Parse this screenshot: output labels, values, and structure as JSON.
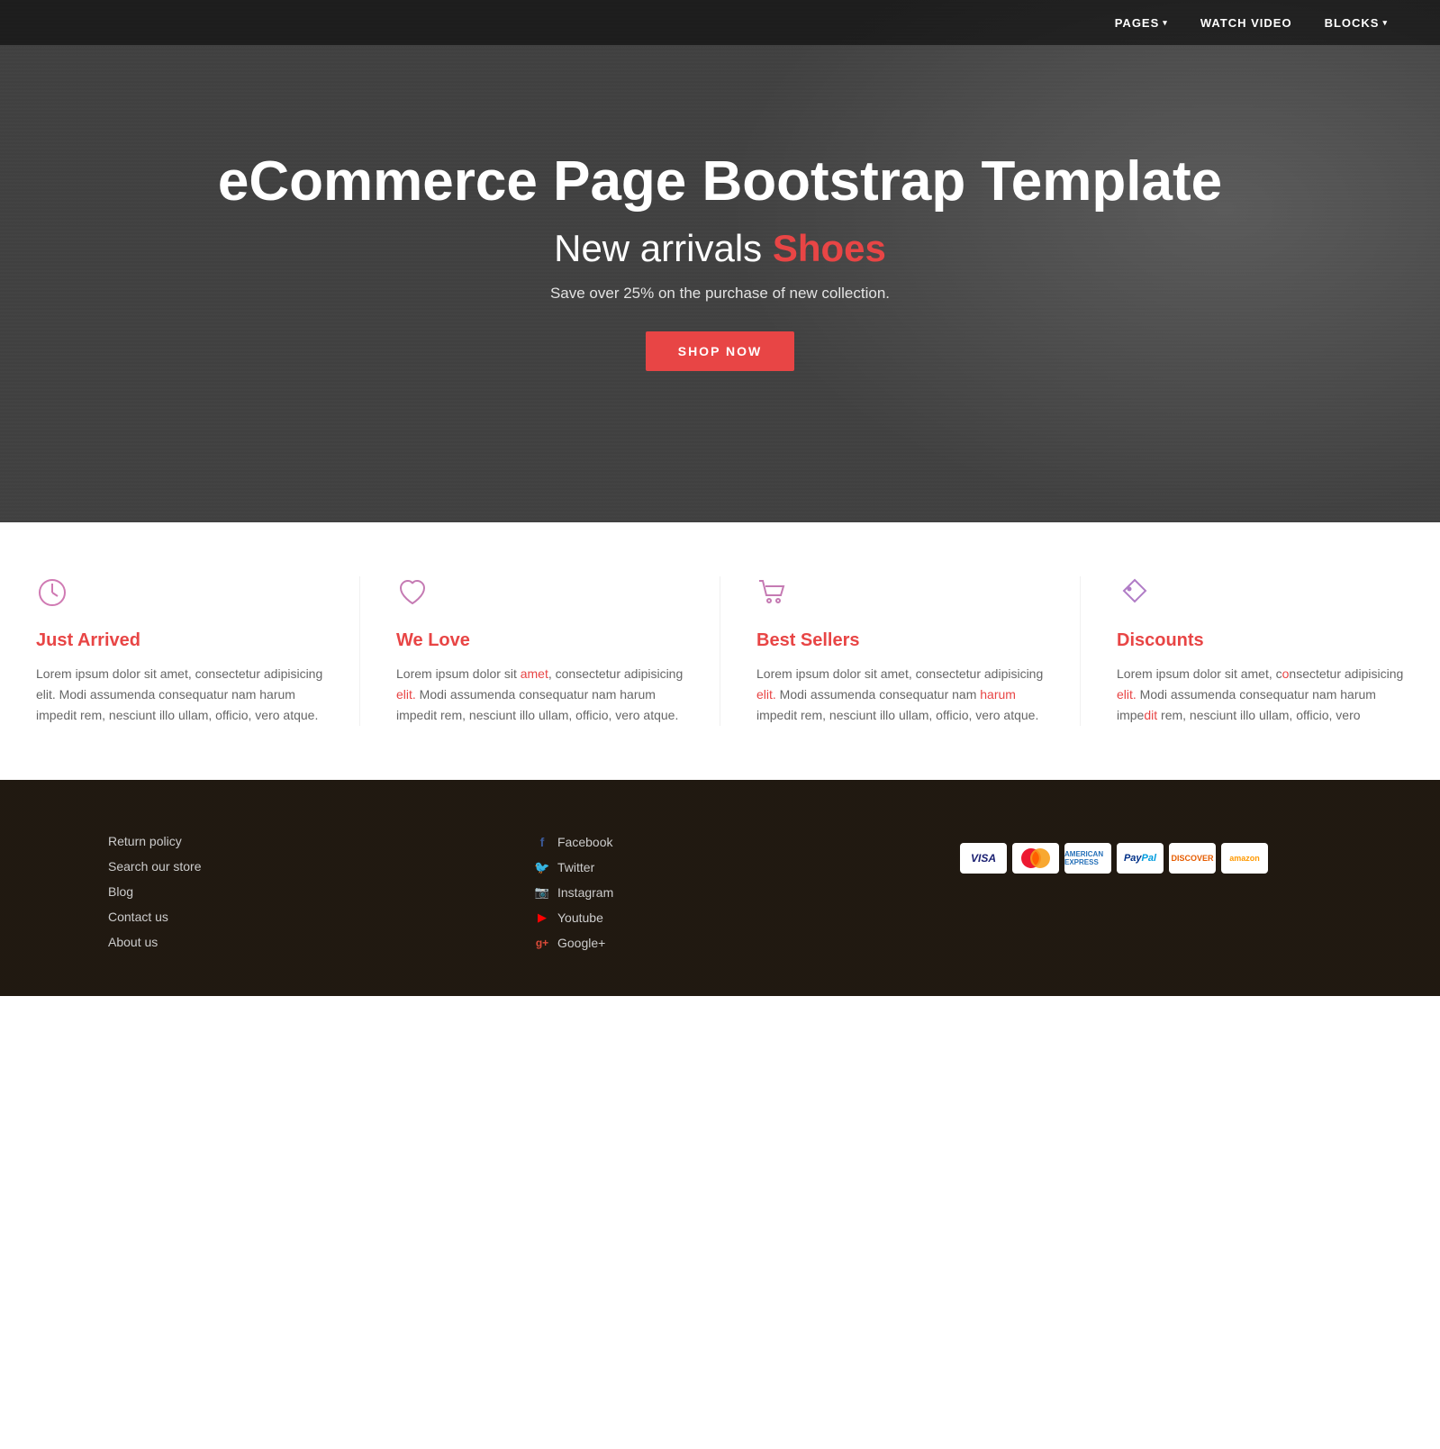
{
  "navbar": {
    "items": [
      {
        "label": "PAGES",
        "has_dropdown": true,
        "key": "pages"
      },
      {
        "label": "WATCH VIDEO",
        "has_dropdown": false,
        "key": "watch-video"
      },
      {
        "label": "BLOCKS",
        "has_dropdown": true,
        "key": "blocks"
      }
    ]
  },
  "hero": {
    "title": "eCommerce Page Bootstrap Template",
    "subtitle": "New arrivals ",
    "subtitle_accent": "Shoes",
    "description": "Save over 25% on the purchase of new collection.",
    "cta_label": "SHOP NOW"
  },
  "features": [
    {
      "key": "just-arrived",
      "icon": "clock",
      "title": "Just Arrived",
      "text": "Lorem ipsum dolor sit amet, consectetur adipisicing elit. Modi assumenda consequatur nam harum impedit rem, nesciunt illo ullam, officio, vero atque."
    },
    {
      "key": "we-love",
      "icon": "heart",
      "title": "We Love",
      "text": "Lorem ipsum dolor sit amet, consectetur adipisicing elit. Modi assumenda consequatur nam harum impedit rem, nesciunt illo ullam, officio, vero atque."
    },
    {
      "key": "best-sellers",
      "icon": "cart",
      "title": "Best Sellers",
      "text": "Lorem ipsum dolor sit amet, consectetur adipisicing elit. Modi assumenda consequatur nam harum impedit rem, nesciunt illo ullam, officio, vero atque."
    },
    {
      "key": "discounts",
      "icon": "tag",
      "title": "Discounts",
      "text": "Lorem ipsum dolor sit amet, consectetur adipisicing elit. Modi assumenda consequatur nam harum impedit rem, nesciunt illo ullam, officio, vero atque."
    }
  ],
  "footer": {
    "links": [
      {
        "label": "Return policy",
        "key": "return-policy"
      },
      {
        "label": "Search our store",
        "key": "search-store"
      },
      {
        "label": "Blog",
        "key": "blog"
      },
      {
        "label": "Contact us",
        "key": "contact-us"
      },
      {
        "label": "About us",
        "key": "about-us"
      }
    ],
    "social": [
      {
        "label": "Facebook",
        "icon": "facebook",
        "key": "facebook"
      },
      {
        "label": "Twitter",
        "icon": "twitter",
        "key": "twitter"
      },
      {
        "label": "Instagram",
        "icon": "instagram",
        "key": "instagram"
      },
      {
        "label": "Youtube",
        "icon": "youtube",
        "key": "youtube"
      },
      {
        "label": "Google+",
        "icon": "google-plus",
        "key": "google-plus"
      }
    ],
    "payment_methods": [
      "VISA",
      "Mastercard",
      "AMEX",
      "PayPal",
      "Discover",
      "Amazon"
    ]
  },
  "feature_text_link_word_1": "amet",
  "feature_text_link_word_2": "elit.",
  "feature_text_link_word_3": "harum"
}
